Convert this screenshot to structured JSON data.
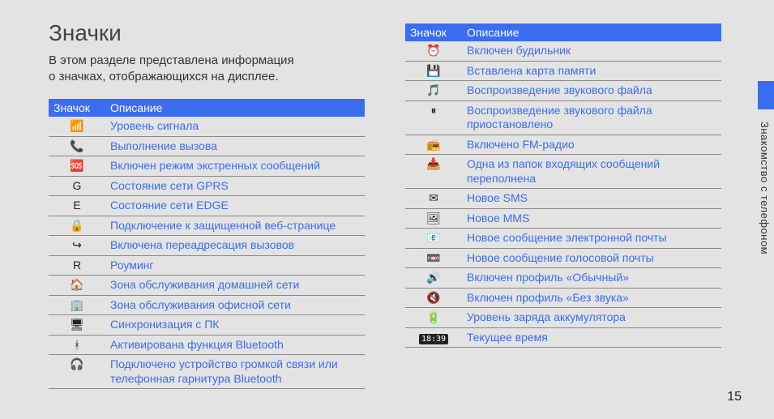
{
  "heading": "Значки",
  "intro_line1": "В этом разделе представлена информация",
  "intro_line2": "о значках, отображающихся на дисплее.",
  "side_caption": "Знакомство с телефоном",
  "page_number": "15",
  "table_header_icon": "Значок",
  "table_header_desc": "Описание",
  "left_rows": [
    {
      "icon": "📶",
      "desc": "Уровень сигнала"
    },
    {
      "icon": "📞",
      "desc": "Выполнение вызова"
    },
    {
      "icon": "🆘",
      "desc": "Включен режим экстренных сообщений"
    },
    {
      "icon": "G",
      "desc": "Состояние сети GPRS"
    },
    {
      "icon": "E",
      "desc": "Состояние сети EDGE"
    },
    {
      "icon": "🔒",
      "desc": "Подключение к защищенной веб-странице"
    },
    {
      "icon": "↪",
      "desc": "Включена переадресация вызовов"
    },
    {
      "icon": "R",
      "desc": "Роуминг"
    },
    {
      "icon": "🏠",
      "desc": "Зона обслуживания домашней сети"
    },
    {
      "icon": "🏢",
      "desc": "Зона обслуживания офисной сети"
    },
    {
      "icon": "🖥",
      "desc": "Синхронизация с ПК"
    },
    {
      "icon": "ᚼ",
      "desc": "Активирована функция Bluetooth"
    },
    {
      "icon": "🎧",
      "desc": "Подключено устройство громкой связи или телефонная гарнитура Bluetooth"
    }
  ],
  "right_rows": [
    {
      "icon": "⏰",
      "desc": "Включен будильник"
    },
    {
      "icon": "💾",
      "desc": "Вставлена карта памяти"
    },
    {
      "icon": "🎵",
      "desc": "Воспроизведение звукового файла"
    },
    {
      "icon": "⏸",
      "desc": "Воспроизведение звукового файла приостановлено"
    },
    {
      "icon": "📻",
      "desc": "Включено FM-радио"
    },
    {
      "icon": "📥",
      "desc": "Одна из папок входящих сообщений переполнена"
    },
    {
      "icon": "✉",
      "desc": "Новое SMS"
    },
    {
      "icon": "🖼",
      "desc": "Новое MMS"
    },
    {
      "icon": "📧",
      "desc": "Новое сообщение электронной почты"
    },
    {
      "icon": "📼",
      "desc": "Новое сообщение голосовой почты"
    },
    {
      "icon": "🔊",
      "desc": "Включен профиль «Обычный»"
    },
    {
      "icon": "🔇",
      "desc": "Включен профиль «Без звука»"
    },
    {
      "icon": "🔋",
      "desc": "Уровень заряда аккумулятора"
    },
    {
      "icon": "18:39",
      "is_time": true,
      "desc": "Текущее время"
    }
  ]
}
